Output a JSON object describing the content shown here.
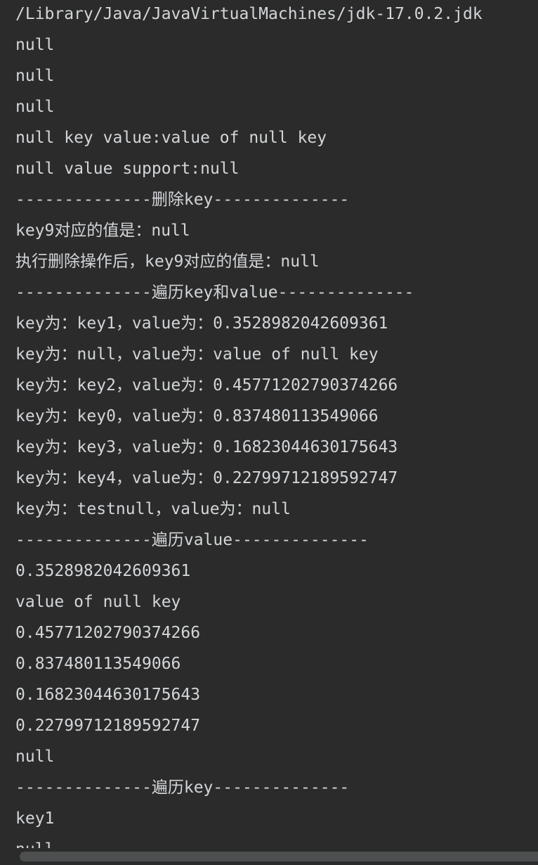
{
  "console": {
    "lines": [
      "/Library/Java/JavaVirtualMachines/jdk-17.0.2.jdk",
      "null",
      "null",
      "null",
      "null key value:value of null key",
      "null value support:null",
      "--------------删除key--------------",
      "key9对应的值是：null",
      "执行删除操作后，key9对应的值是：null",
      "--------------遍历key和value--------------",
      "key为：key1，value为：0.3528982042609361",
      "key为：null，value为：value of null key",
      "key为：key2，value为：0.45771202790374266",
      "key为：key0，value为：0.837480113549066",
      "key为：key3，value为：0.16823044630175643",
      "key为：key4，value为：0.22799712189592747",
      "key为：testnull，value为：null",
      "--------------遍历value--------------",
      "0.3528982042609361",
      "value of null key",
      "0.45771202790374266",
      "0.837480113549066",
      "0.16823044630175643",
      "0.22799712189592747",
      "null",
      "--------------遍历key--------------",
      "key1",
      "null"
    ]
  },
  "colors": {
    "background": "#2b2b2b",
    "text": "#d3d6d9",
    "scrollbar_thumb": "#4c4e50"
  }
}
